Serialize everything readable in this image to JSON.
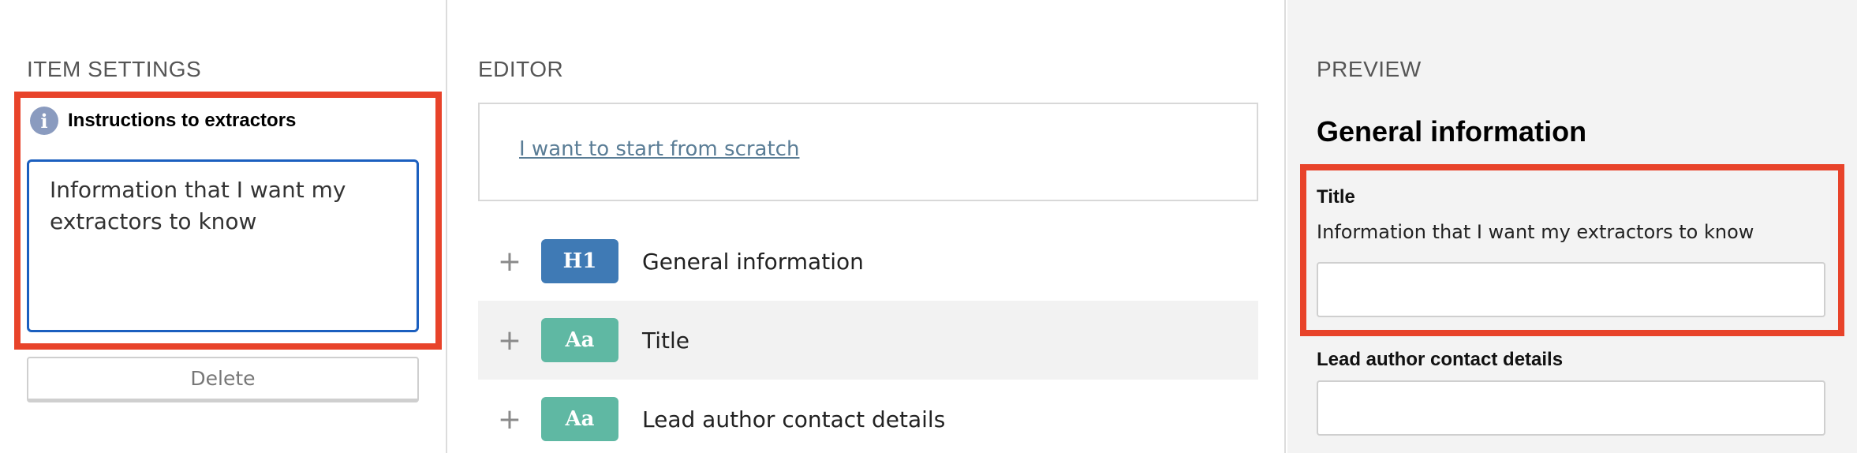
{
  "settings": {
    "heading": "ITEM SETTINGS",
    "instructions_label": "Instructions to extractors",
    "info_icon": "info-icon",
    "instructions_value": "Information that I want my extractors to know",
    "delete_label": "Delete"
  },
  "editor": {
    "heading": "EDITOR",
    "start_link": "I want to start from scratch",
    "rows": [
      {
        "badge": "H1",
        "label": "General information"
      },
      {
        "badge": "Aa",
        "label": "Title"
      },
      {
        "badge": "Aa",
        "label": "Lead author contact details"
      }
    ],
    "add_glyph": "+"
  },
  "preview": {
    "heading": "PREVIEW",
    "title": "General information",
    "fields": [
      {
        "label": "Title",
        "help": "Information that I want my extractors to know"
      },
      {
        "label": "Lead author contact details",
        "help": ""
      }
    ]
  },
  "colors": {
    "highlight": "#e8432a",
    "h1_badge": "#3f7ab5",
    "aa_badge": "#5fb8a3",
    "focus_border": "#1b5fbf"
  }
}
